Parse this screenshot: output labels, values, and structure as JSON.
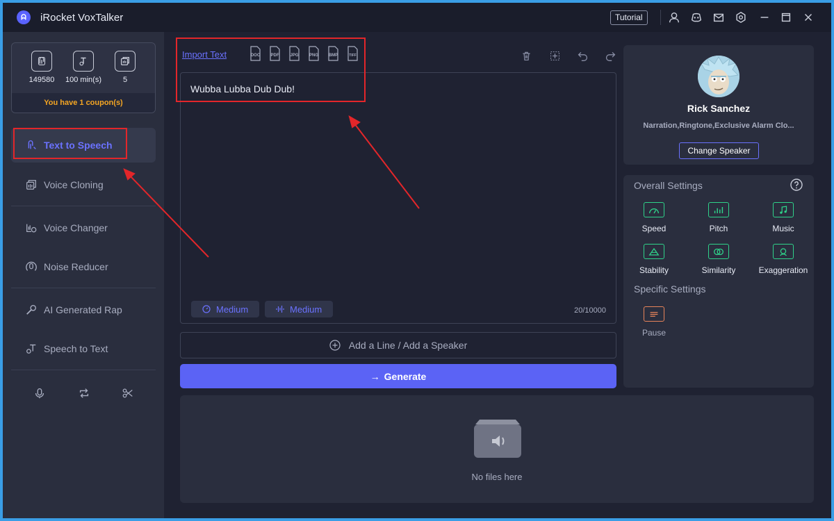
{
  "app": {
    "title": "iRocket VoxTalker",
    "tutorial_label": "Tutorial",
    "titlebar_icons": [
      "user-icon",
      "discord-icon",
      "mail-icon",
      "settings-icon",
      "minimize-icon",
      "maximize-icon",
      "close-icon"
    ]
  },
  "sidebar": {
    "stats": [
      {
        "icon": "character-count-icon",
        "value": "149580"
      },
      {
        "icon": "minutes-icon",
        "value": "100 min(s)"
      },
      {
        "icon": "clone-count-icon",
        "value": "5"
      }
    ],
    "coupon_text": "You have 1 coupon(s)",
    "nav": [
      {
        "label": "Text to Speech",
        "active": true
      },
      {
        "label": "Voice Cloning",
        "active": false
      },
      {
        "label": "Voice Changer",
        "active": false
      },
      {
        "label": "Noise Reducer",
        "active": false
      },
      {
        "label": "AI Generated Rap",
        "active": false
      },
      {
        "label": "Speech to Text",
        "active": false
      }
    ],
    "bottom_icons": [
      "microphone-icon",
      "convert-icon",
      "cut-icon"
    ]
  },
  "editor": {
    "import_label": "Import Text",
    "file_types": [
      "DOC",
      "PDF",
      "JPG",
      "PNG",
      "BMP",
      "TIFF"
    ],
    "tools": [
      "delete-icon",
      "add-block-icon",
      "undo-icon",
      "redo-icon"
    ],
    "text": "Wubba Lubba Dub Dub!",
    "speed_chip": "Medium",
    "pitch_chip": "Medium",
    "counter": "20/10000",
    "add_line_label": "Add a Line / Add a Speaker",
    "generate_label": "Generate"
  },
  "output": {
    "empty_text": "No files here"
  },
  "speaker": {
    "name": "Rick Sanchez",
    "tags": "Narration,Ringtone,Exclusive Alarm Clo...",
    "change_label": "Change Speaker"
  },
  "settings": {
    "overall_title": "Overall Settings",
    "overall": [
      {
        "label": "Speed",
        "icon": "speed-icon"
      },
      {
        "label": "Pitch",
        "icon": "pitch-icon"
      },
      {
        "label": "Music",
        "icon": "music-icon"
      },
      {
        "label": "Stability",
        "icon": "stability-icon"
      },
      {
        "label": "Similarity",
        "icon": "similarity-icon"
      },
      {
        "label": "Exaggeration",
        "icon": "exaggeration-icon"
      }
    ],
    "specific_title": "Specific Settings",
    "specific": [
      {
        "label": "Pause",
        "icon": "pause-icon"
      }
    ]
  },
  "colors": {
    "accent": "#5b63f5",
    "accent_text": "#6b72ff",
    "coupon": "#f5a623",
    "setting_icon": "#2fd38a",
    "pause_icon": "#e8855a",
    "annotation": "#e3262a",
    "window_border": "#3a9ee6"
  }
}
